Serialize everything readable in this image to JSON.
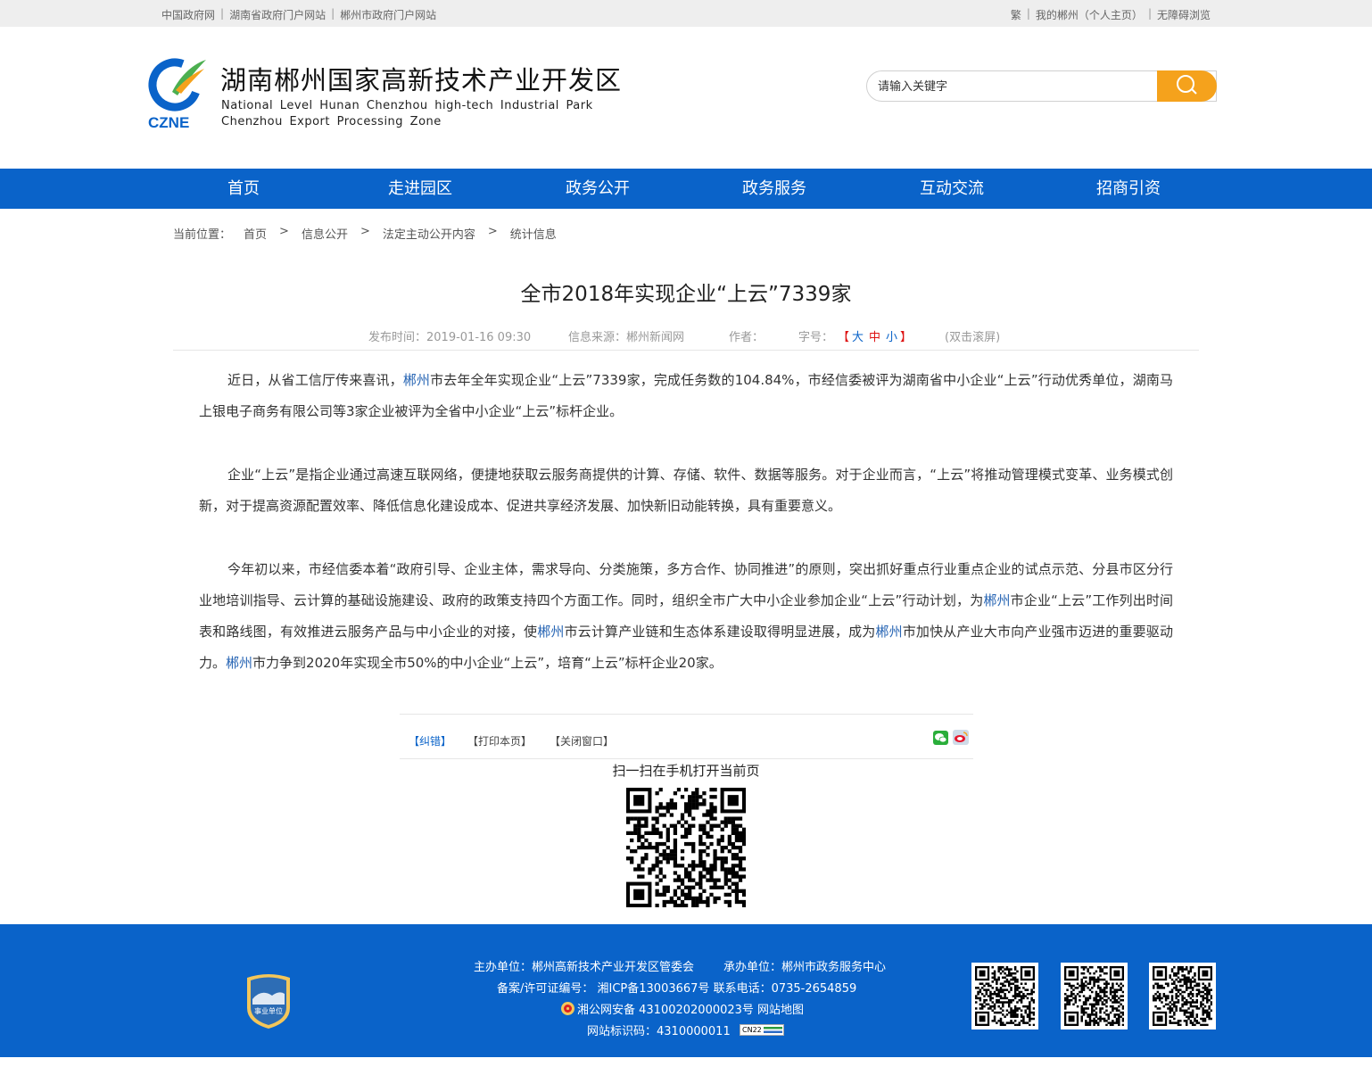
{
  "topbar": {
    "left_links": [
      "中国政府网",
      "湖南省政府门户网站",
      "郴州市政府门户网站"
    ],
    "right_links": [
      "繁",
      "我的郴州（个人主页）",
      "无障碍浏览"
    ]
  },
  "header": {
    "logo_abbr": "CZNE",
    "title_cn": "湖南郴州国家高新技术产业开发区",
    "title_en_line1": "National Level Hunan Chenzhou high-tech Industrial Park",
    "title_en_line2": "Chenzhou Export Processing Zone",
    "search_placeholder": "请输入关键字"
  },
  "nav": [
    "首页",
    "走进园区",
    "政务公开",
    "政务服务",
    "互动交流",
    "招商引资"
  ],
  "breadcrumb": {
    "prefix": "当前位置：",
    "items": [
      "首页",
      "信息公开",
      "法定主动公开内容",
      "统计信息"
    ],
    "separator": ">"
  },
  "article": {
    "title": "全市2018年实现企业“上云”7339家",
    "publish_time": "发布时间：2019-01-16 09:30",
    "source": "信息来源：郴州新闻网",
    "author": "作者：",
    "font_size_label": "字号：",
    "font_size_open": "【",
    "font_large": "大",
    "font_medium": "中",
    "font_small": "小",
    "font_size_close": "】",
    "dblclick_scroll": "(双击滚屏)",
    "paragraphs": [
      [
        {
          "t": "近日，从省工信厅传来喜讯，"
        },
        {
          "t": "郴州",
          "hl": true
        },
        {
          "t": "市去年全年实现企业“上云”7339家，完成任务数的104.84%，市经信委被评为湖南省中小企业“上云”行动优秀单位，湖南马上银电子商务有限公司等3家企业被评为全省中小企业“上云”标杆企业。"
        }
      ],
      [
        {
          "t": "企业“上云”是指企业通过高速互联网络，便捷地获取云服务商提供的计算、存储、软件、数据等服务。对于企业而言，“上云”将推动管理模式变革、业务模式创新，对于提高资源配置效率、降低信息化建设成本、促进共享经济发展、加快新旧动能转换，具有重要意义。"
        }
      ],
      [
        {
          "t": "今年初以来，市经信委本着“政府引导、企业主体，需求导向、分类施策，多方合作、协同推进”的原则，突出抓好重点行业重点企业的试点示范、分县市区分行业地培训指导、云计算的基础设施建设、政府的政策支持四个方面工作。同时，组织全市广大中小企业参加企业“上云”行动计划，为"
        },
        {
          "t": "郴州",
          "hl": true
        },
        {
          "t": "市企业“上云”工作列出时间表和路线图，有效推进云服务产品与中小企业的对接，使"
        },
        {
          "t": "郴州",
          "hl": true
        },
        {
          "t": "市云计算产业链和生态体系建设取得明显进展，成为"
        },
        {
          "t": "郴州",
          "hl": true
        },
        {
          "t": "市加快从产业大市向产业强市迈进的重要驱动力。"
        },
        {
          "t": "郴州",
          "hl": true
        },
        {
          "t": "市力争到2020年实现全市50%的中小企业“上云”，培育“上云”标杆企业20家。"
        }
      ]
    ]
  },
  "tools": {
    "correct": "【纠错】",
    "print": "【打印本页】",
    "close": "【关闭窗口】",
    "scan_text": "扫一扫在手机打开当前页"
  },
  "footer": {
    "badge_text": "事业单位",
    "host": "主办单位：郴州高新技术产业开发区管委会",
    "undertaker": "承办单位：郴州市政务服务中心",
    "icp": "备案/许可证编号： 湘ICP备13003667号 联系电话：0735-2654859",
    "police": "湘公网安备 43100202000023号 网站地图",
    "site_code": "网站标识码：4310000011",
    "site_code_badge": "CN22"
  }
}
